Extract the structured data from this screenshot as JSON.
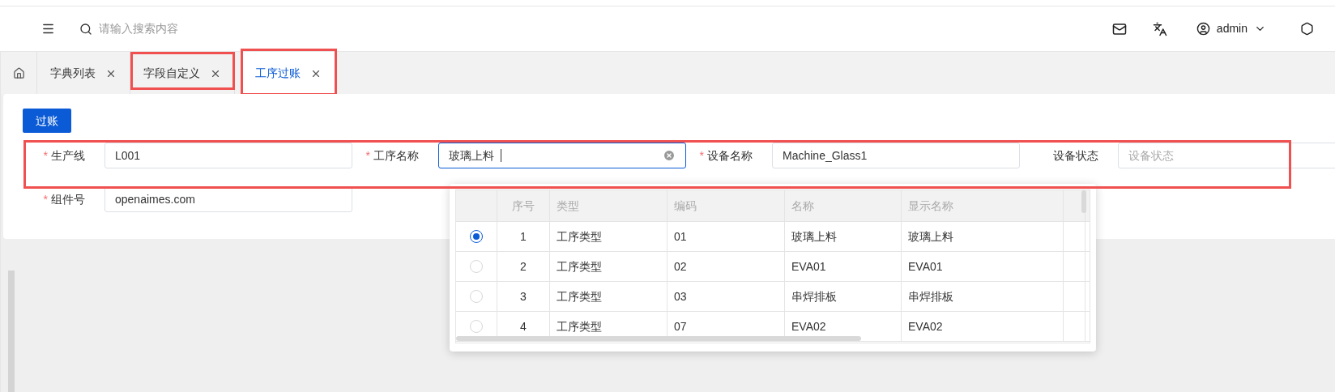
{
  "header": {
    "search": {
      "placeholder": "请输入搜索内容"
    },
    "user": "admin"
  },
  "tabs": [
    {
      "label": "字典列表",
      "selected": false,
      "highlighted": false
    },
    {
      "label": "字段自定义",
      "selected": false,
      "highlighted": true
    },
    {
      "label": "工序过账",
      "selected": true,
      "highlighted": true
    }
  ],
  "post_button": "过账",
  "form": {
    "highlighted_row": true,
    "row_1": [
      {
        "label": "生产线",
        "required_mark": "*",
        "value": "L001",
        "focused": false
      },
      {
        "label": "工序名称",
        "required_mark": "*",
        "value": "玻璃上料",
        "focused": true
      },
      {
        "label": "设备名称",
        "required_mark": "*",
        "value": "Machine_Glass1",
        "focused": false
      },
      {
        "label": "设备状态",
        "placeholder": "设备状态",
        "focused": false
      }
    ],
    "row_2": [
      {
        "label": "组件号",
        "required_mark": "*",
        "value": "openaimes.com",
        "focused": false
      }
    ]
  },
  "dropdown": {
    "columns": [
      "序号",
      "类型",
      "编码",
      "名称",
      "显示名称"
    ],
    "rows": [
      {
        "selected": true,
        "cells": [
          "1",
          "工序类型",
          "01",
          "玻璃上料",
          "玻璃上料"
        ]
      },
      {
        "selected": false,
        "cells": [
          "2",
          "工序类型",
          "02",
          "EVA01",
          "EVA01"
        ]
      },
      {
        "selected": false,
        "cells": [
          "3",
          "工序类型",
          "03",
          "串焊排板",
          "串焊排板"
        ]
      },
      {
        "selected": false,
        "cells": [
          "4",
          "工序类型",
          "07",
          "EVA02",
          "EVA02"
        ]
      }
    ]
  }
}
